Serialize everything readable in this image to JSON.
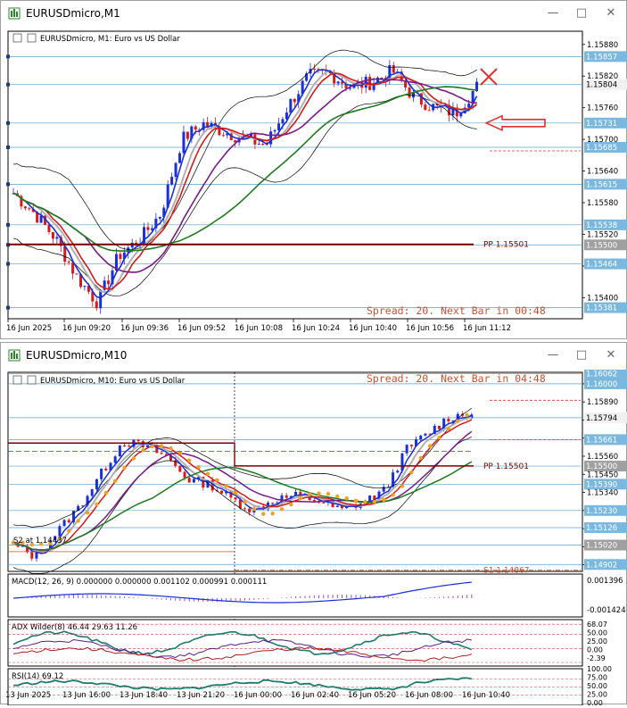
{
  "w1": {
    "title": "EURUSDmicro,M1",
    "chart_label": "EURUSDmicro, M1:  Euro vs US Dollar",
    "spread_text": "Spread: 20. Next Bar in 00:48",
    "pp_label": "PP 1.15501",
    "price_ticks": [
      "1.15880",
      "1.15820",
      "1.15760",
      "1.15700",
      "1.15640",
      "1.15580",
      "1.15520",
      "1.15460",
      "1.15400"
    ],
    "price_boxes": [
      "1.15857",
      "1.15804",
      "1.15731",
      "1.15685",
      "1.15615",
      "1.15538",
      "1.15500",
      "1.15464",
      "1.15381"
    ],
    "time_labels": [
      "16 Jun 2025",
      "16 Jun 09:20",
      "16 Jun 09:36",
      "16 Jun 09:52",
      "16 Jun 10:08",
      "16 Jun 10:24",
      "16 Jun 10:40",
      "16 Jun 10:56",
      "16 Jun 11:12"
    ]
  },
  "w2": {
    "title": "EURUSDmicro,M10",
    "chart_label": "EURUSDmicro, M10:  Euro vs US Dollar",
    "spread_text": "Spread: 20. Next Bar in 04:48",
    "pp_label": "PP 1.15501",
    "s1_label": "S1 1.14867",
    "s2_text": "S2 at 1.14437",
    "price_ticks": [
      "1.16000",
      "1.15890",
      "1.15780",
      "1.15670",
      "1.15560",
      "1.15450",
      "1.15340",
      "1.15230",
      "1.15120",
      "1.15010",
      "1.14900"
    ],
    "price_boxes": [
      "1.16062",
      "1.16000",
      "1.15794",
      "1.15661",
      "1.15500",
      "1.15390",
      "1.15230",
      "1.15126",
      "1.15020",
      "1.14902"
    ],
    "macd_label": "MACD(12, 26, 9) 0.000000 0.000000 0.001102 0.000991 0.000111",
    "macd_ticks": [
      "0.001396",
      "-0.001424"
    ],
    "adx_label": "ADX Wilder(8) 46.44 29.63 11.26",
    "adx_ticks": [
      "68.07",
      "50.00",
      "25.00",
      "0.00",
      "-2.39"
    ],
    "rsi_label": "RSI(14) 69.12",
    "rsi_ticks": [
      "100.00",
      "75.00",
      "50.00",
      "25.00",
      "0.00"
    ],
    "time_labels": [
      "13 Jun 2025",
      "13 Jun 16:00",
      "13 Jun 18:40",
      "13 Jun 21:20",
      "16 Jun 00:00",
      "16 Jun 02:40",
      "16 Jun 05:20",
      "16 Jun 08:00",
      "16 Jun 10:40"
    ]
  },
  "colors": {
    "sma_fast": "#1a2fd6",
    "sma_mid": "#d61a1a",
    "sma_slow": "#7a1a8a",
    "sma_long": "#1e7a1e",
    "bollinger": "#000000",
    "grey_ma": "#b0b0b0",
    "pivot": "#7a0000",
    "spread": "#d2502a",
    "level_line": "#5aa0d0",
    "arrow": "#e03030",
    "dots": "#f0a020"
  }
}
